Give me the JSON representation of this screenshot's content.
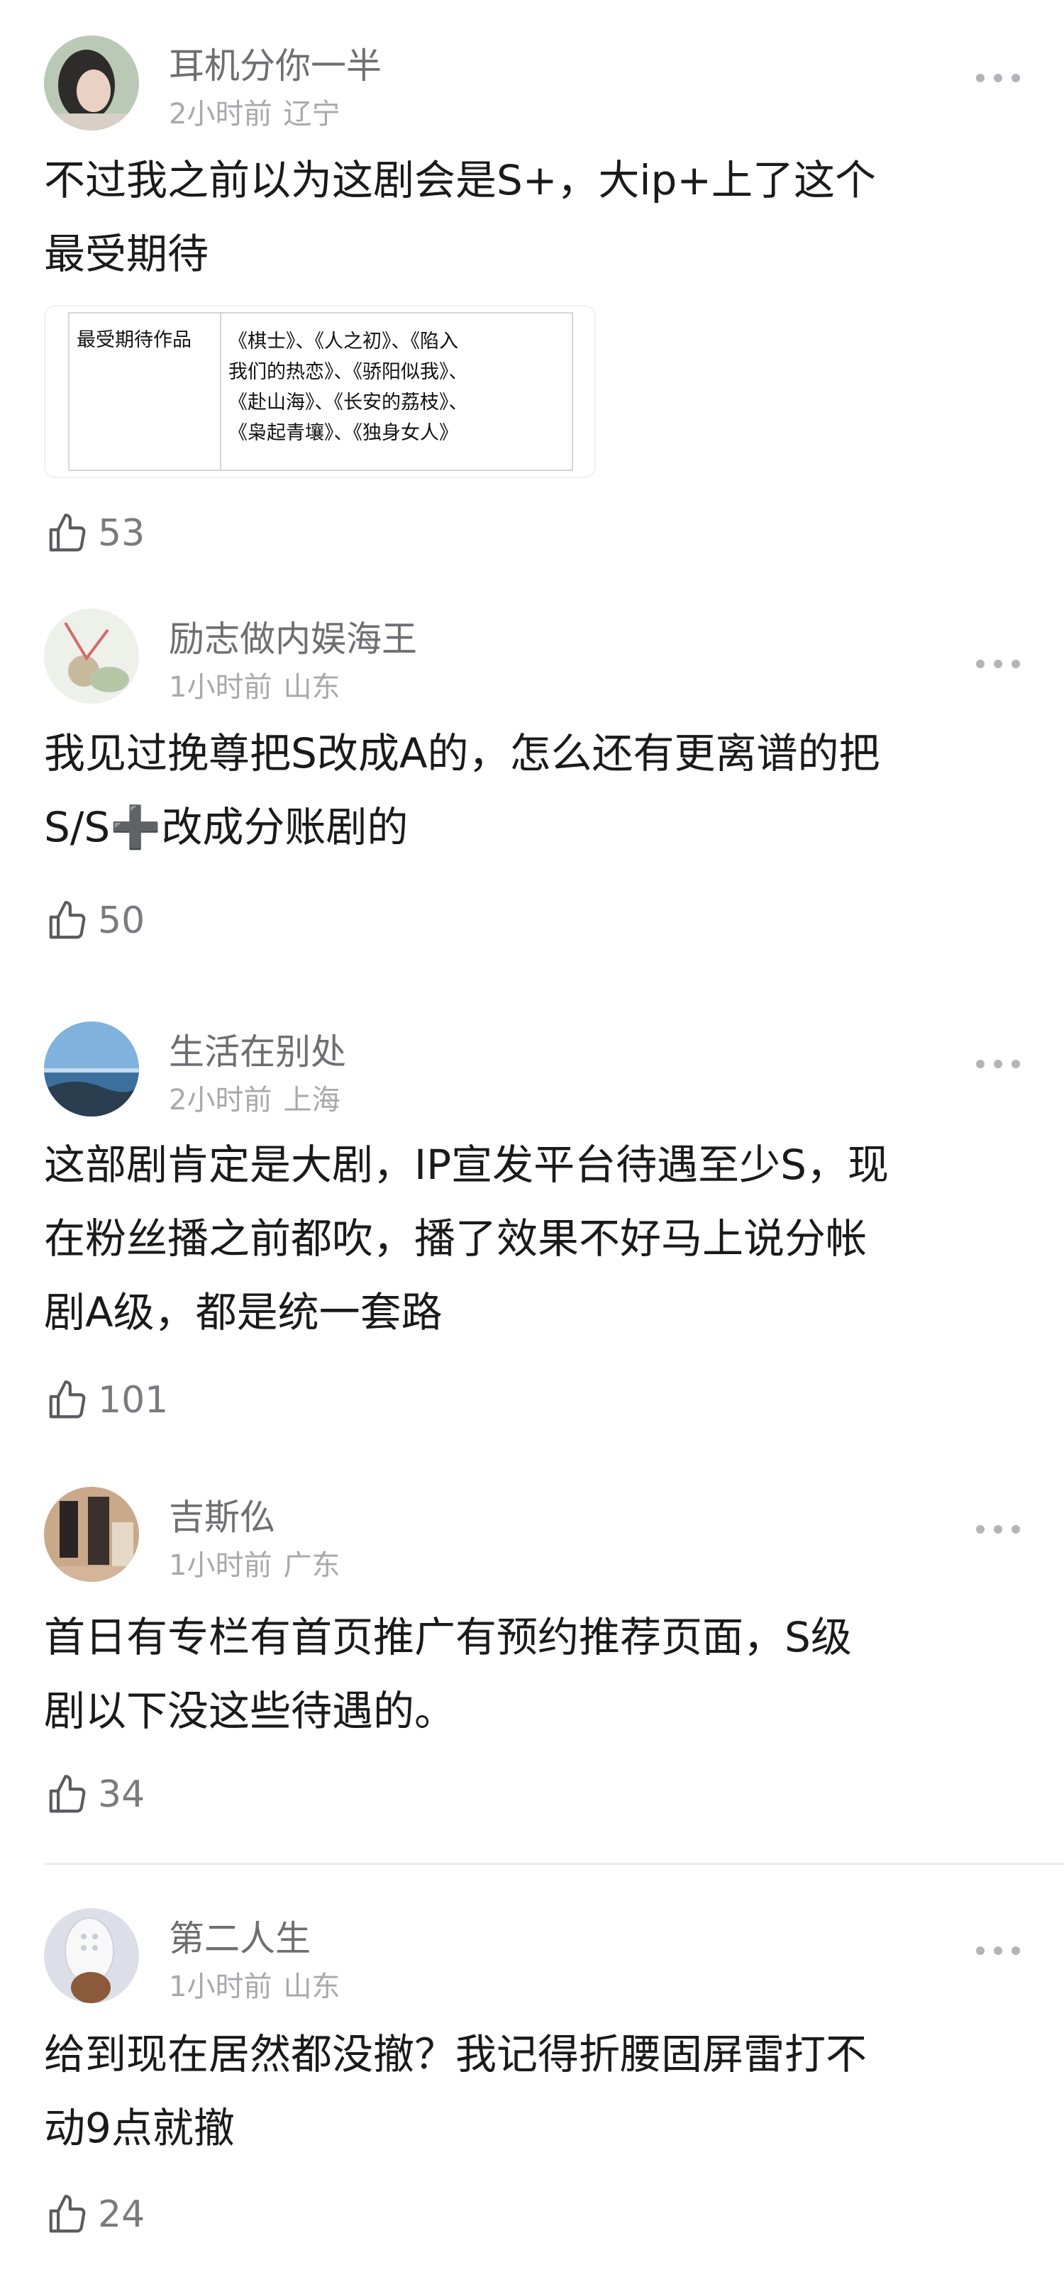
{
  "comments": [
    {
      "username": "耳机分你一半",
      "time": "2小时前",
      "location": "辽宁",
      "lines": [
        "不过我之前以为这剧会是S+，大ip+上了这个",
        "最受期待"
      ],
      "likes": "53",
      "avatar": "avatar-woman-photo",
      "embed": {
        "header": "最受期待作品",
        "lines": [
          "《棋士》、《人之初》、《陷入",
          "我们的热恋》、《骄阳似我》、",
          "《赴山海》、《长安的荔枝》、",
          "《枭起青壤》、《独身女人》"
        ]
      }
    },
    {
      "username": "励志做内娱海王",
      "time": "1小时前",
      "location": "山东",
      "lines": [
        "我见过挽尊把S改成A的，怎么还有更离谱的把",
        "S/S➕改成分账剧的"
      ],
      "likes": "50",
      "avatar": "avatar-illustration"
    },
    {
      "username": "生活在别处",
      "time": "2小时前",
      "location": "上海",
      "lines": [
        "这部剧肯定是大剧，IP宣发平台待遇至少S，现",
        "在粉丝播之前都吹，播了效果不好马上说分帐",
        "剧A级，都是统一套路"
      ],
      "likes": "101",
      "avatar": "avatar-sea-landscape"
    },
    {
      "username": "吉斯仫",
      "time": "1小时前",
      "location": "广东",
      "lines": [
        "首日有专栏有首页推广有预约推荐页面，S级",
        "剧以下没这些待遇的。"
      ],
      "likes": "34",
      "avatar": "avatar-people-photo"
    },
    {
      "username": "第二人生",
      "time": "1小时前",
      "location": "山东",
      "lines": [
        "给到现在居然都没撤？我记得折腰固屏雷打不",
        "动9点就撤"
      ],
      "likes": "24",
      "avatar": "avatar-dog-clog"
    }
  ],
  "colors": {
    "username": "#6e6e73",
    "meta": "#a8a8ad",
    "text": "#1a1a1a",
    "likes": "#7a7a7f"
  }
}
